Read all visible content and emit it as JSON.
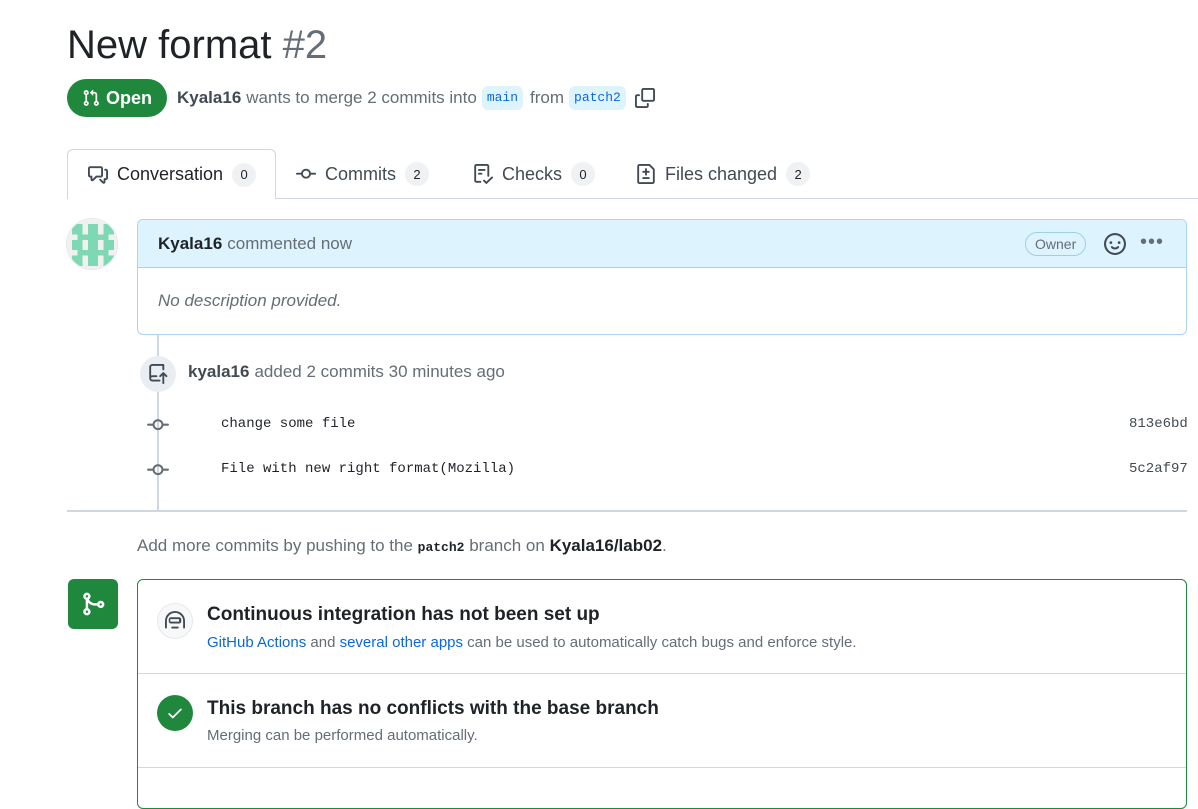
{
  "pr": {
    "title": "New format",
    "number": "#2",
    "state": "Open",
    "author": "Kyala16",
    "merge_text": "wants to merge 2 commits into",
    "base_branch": "main",
    "from_text": "from",
    "head_branch": "patch2"
  },
  "tabs": [
    {
      "label": "Conversation",
      "count": "0",
      "icon": "comment-discussion-icon"
    },
    {
      "label": "Commits",
      "count": "2",
      "icon": "git-commit-icon"
    },
    {
      "label": "Checks",
      "count": "0",
      "icon": "checklist-icon"
    },
    {
      "label": "Files changed",
      "count": "2",
      "icon": "file-diff-icon"
    }
  ],
  "comment": {
    "author": "Kyala16",
    "action": "commented now",
    "badge": "Owner",
    "body": "No description provided."
  },
  "event": {
    "author": "kyala16",
    "text": "added 2 commits 30 minutes ago"
  },
  "commits": [
    {
      "message": "change some file",
      "sha": "813e6bd"
    },
    {
      "message": "File with new right format(Mozilla)",
      "sha": "5c2af97"
    }
  ],
  "push_hint": {
    "before": "Add more commits by pushing to the",
    "branch": "patch2",
    "middle": "branch on",
    "repo": "Kyala16/lab02",
    "end": "."
  },
  "merge_box": {
    "ci_title": "Continuous integration has not been set up",
    "ci_link1": "GitHub Actions",
    "ci_and": "and",
    "ci_link2": "several other apps",
    "ci_rest": "can be used to automatically catch bugs and enforce style.",
    "conflict_title": "This branch has no conflicts with the base branch",
    "conflict_sub": "Merging can be performed automatically."
  },
  "colors": {
    "accent_green": "#1f883d",
    "link_blue": "#0969da",
    "comment_header_bg": "#ddf4ff"
  }
}
